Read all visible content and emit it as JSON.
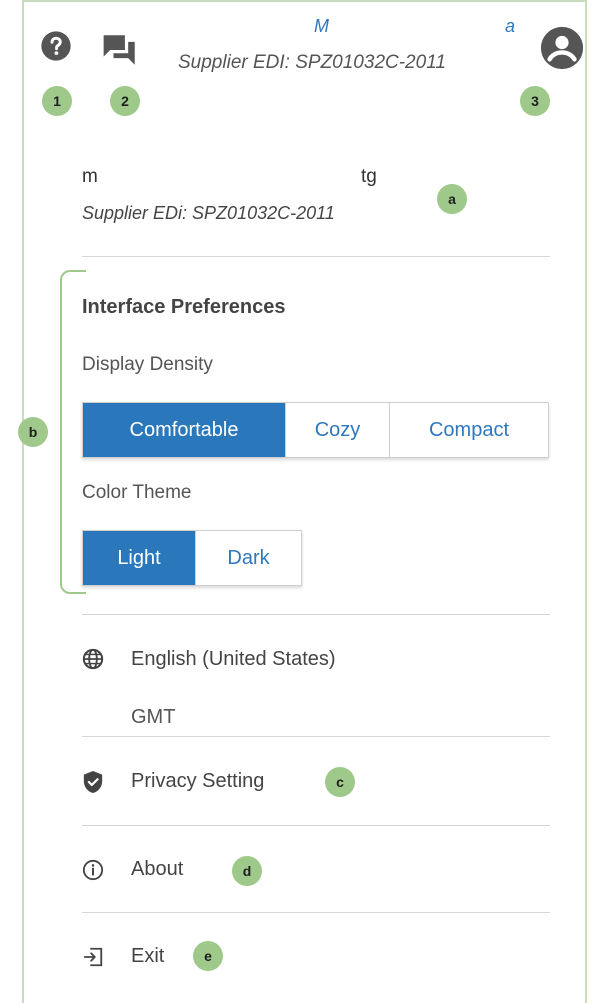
{
  "header": {
    "name_left": "M",
    "name_right": "a",
    "supplier_edi": "Supplier EDI: SPZ01032C-2011"
  },
  "user": {
    "name_left": "m",
    "name_right": "tg",
    "supplier_edi": "Supplier EDi: SPZ01032C-2011"
  },
  "badges": {
    "help": "1",
    "messages": "2",
    "profile": "3",
    "user_info": "a",
    "preferences": "b",
    "privacy": "c",
    "about": "d",
    "exit": "e"
  },
  "preferences": {
    "title": "Interface Preferences",
    "density_label": "Display Density",
    "density_options": [
      "Comfortable",
      "Cozy",
      "Compact"
    ],
    "density_selected": "Comfortable",
    "theme_label": "Color Theme",
    "theme_options": [
      "Light",
      "Dark"
    ],
    "theme_selected": "Light"
  },
  "locale": {
    "language": "English (United States)",
    "timezone": "GMT"
  },
  "menu": {
    "privacy": "Privacy Setting",
    "about": "About",
    "exit": "Exit"
  },
  "colors": {
    "accent": "#2a77bb",
    "badge": "#9fc98a",
    "icon": "#555555"
  },
  "icons": {
    "help": "help-circle-icon",
    "messages": "chat-bubbles-icon",
    "profile": "account-circle-icon",
    "language": "globe-icon",
    "privacy": "shield-check-icon",
    "about": "info-icon",
    "exit": "exit-icon"
  }
}
